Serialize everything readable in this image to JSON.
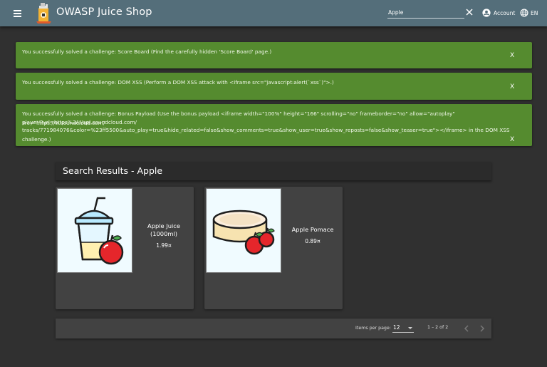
{
  "toolbar": {
    "title": "OWASP Juice Shop",
    "search_value": "Apple",
    "account_label": "Account",
    "language_label": "EN"
  },
  "alerts": [
    {
      "text": "You successfully solved a challenge: Score Board (Find the carefully hidden 'Score Board' page.)",
      "close": "X"
    },
    {
      "text": "You successfully solved a challenge: DOM XSS (Perform a DOM XSS attack with <iframe src=\"javascript:alert(`xss`)\">.)",
      "close": "X"
    },
    {
      "text_lines": [
        "You successfully solved a challenge: Bonus Payload (Use the bonus payload <iframe width=\"100%\" height=\"166\" scrolling=\"no\" frameborder=\"no\" allow=\"autoplay\" src=\"https://w.soundcloud.com/",
        "player/?url=https%3A//api.soundcloud.com/",
        "tracks/771984076&color=%23ff5500&auto_play=true&hide_related=false&show_comments=true&show_user=true&show_reposts=false&show_teaser=true\"></iframe> in the DOM XSS challenge.)"
      ],
      "close": "X"
    }
  ],
  "results": {
    "title": "Search Results - Apple",
    "products": [
      {
        "name_lines": [
          "Apple Juice",
          "(1000ml)"
        ],
        "price": "1.99¤",
        "icon": "juice-cup-apple-icon"
      },
      {
        "name_lines": [
          "Apple Pomace"
        ],
        "price": "0.89¤",
        "icon": "pomace-apples-icon"
      }
    ]
  },
  "paginator": {
    "items_per_page_label": "Items per page:",
    "items_per_page_value": "12",
    "range_label": "1 – 2 of 2"
  },
  "colors": {
    "toolbar": "#546e7a",
    "background": "#303030",
    "alert": "#558b2f",
    "card": "#424242"
  }
}
